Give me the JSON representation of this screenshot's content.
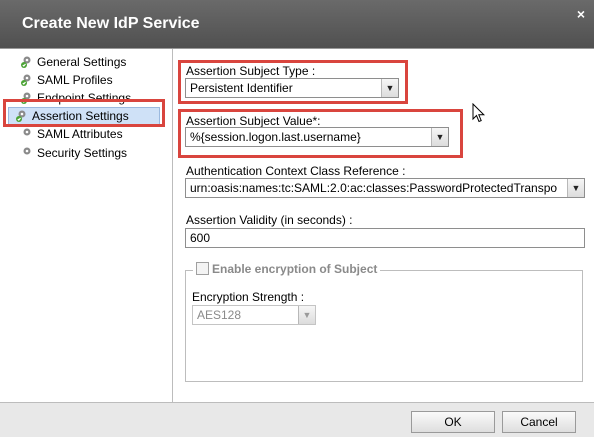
{
  "dialog": {
    "title": "Create New IdP Service",
    "close_icon": "×"
  },
  "nav": {
    "items": [
      {
        "label": "General Settings",
        "icon": "gear-icon"
      },
      {
        "label": "SAML Profiles",
        "icon": "gear-icon"
      },
      {
        "label": "Endpoint Settings",
        "icon": "gear-icon"
      },
      {
        "label": "Assertion Settings",
        "icon": "gear-icon",
        "selected": true
      },
      {
        "label": "SAML Attributes",
        "icon": "gear-icon"
      },
      {
        "label": "Security Settings",
        "icon": "gear-icon"
      }
    ]
  },
  "form": {
    "subject_type": {
      "label": "Assertion Subject Type :",
      "value": "Persistent Identifier"
    },
    "subject_value": {
      "label": "Assertion Subject Value*:",
      "value": "%{session.logon.last.username}"
    },
    "auth_context": {
      "label": "Authentication Context Class Reference :",
      "value": "urn:oasis:names:tc:SAML:2.0:ac:classes:PasswordProtectedTranspo"
    },
    "validity": {
      "label": "Assertion Validity (in seconds) :",
      "value": "600"
    },
    "encryption": {
      "legend": "Enable encryption of Subject",
      "checked": false,
      "strength_label": "Encryption Strength :",
      "strength_value": "AES128"
    }
  },
  "footer": {
    "ok_label": "OK",
    "cancel_label": "Cancel"
  },
  "colors": {
    "highlight": "#d9453e",
    "selected_bg": "#cfe1f7"
  }
}
